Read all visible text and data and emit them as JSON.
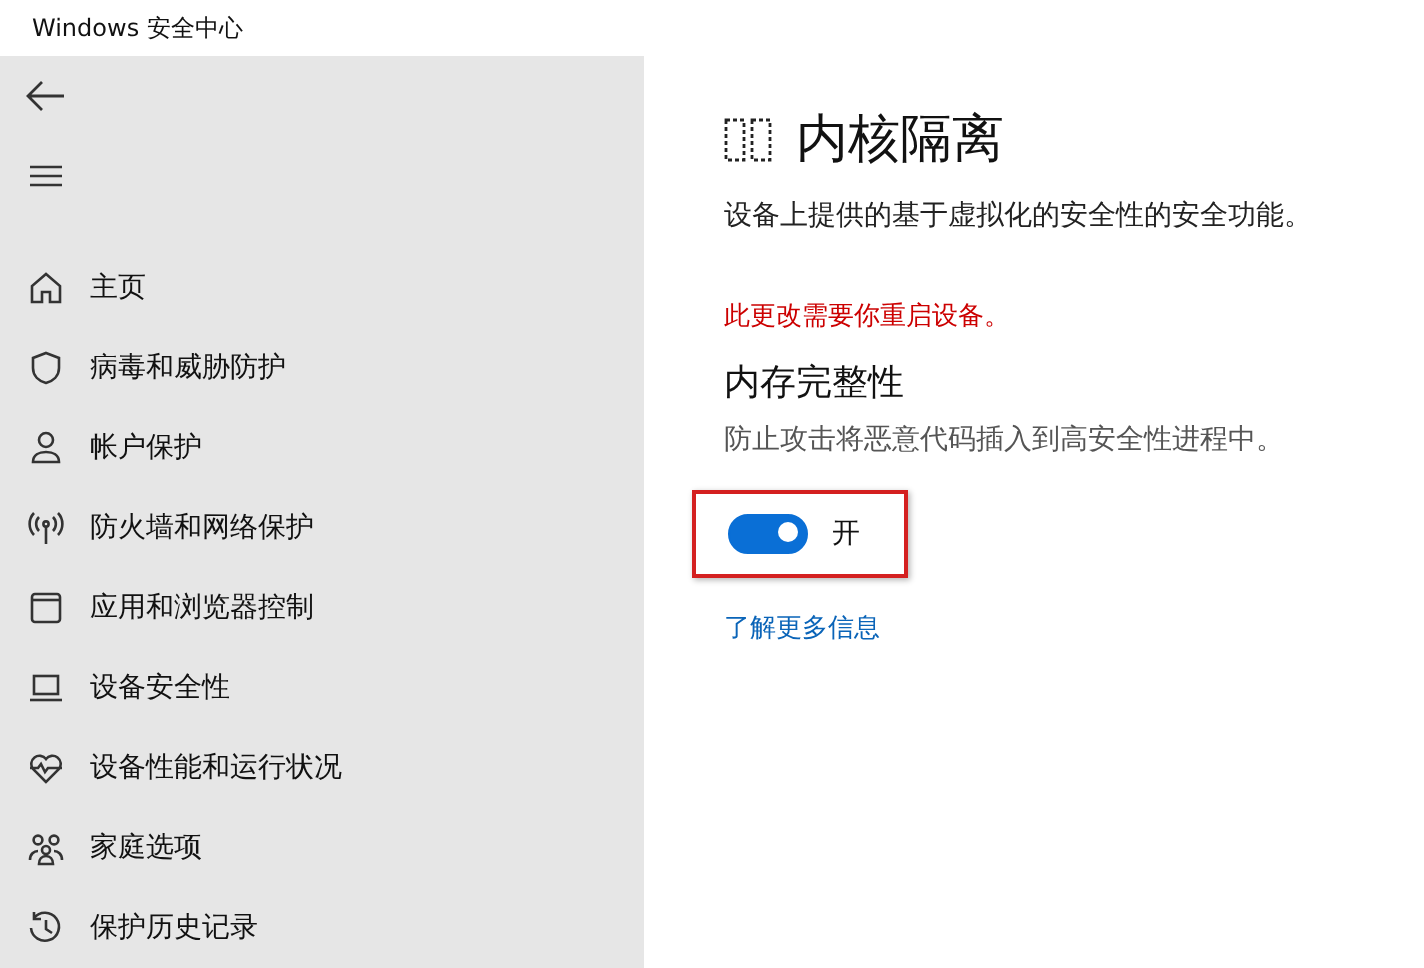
{
  "window": {
    "title": "Windows 安全中心"
  },
  "sidebar": {
    "items": [
      {
        "label": "主页"
      },
      {
        "label": "病毒和威胁防护"
      },
      {
        "label": "帐户保护"
      },
      {
        "label": "防火墙和网络保护"
      },
      {
        "label": "应用和浏览器控制"
      },
      {
        "label": "设备安全性"
      },
      {
        "label": "设备性能和运行状况"
      },
      {
        "label": "家庭选项"
      },
      {
        "label": "保护历史记录"
      }
    ]
  },
  "page": {
    "title": "内核隔离",
    "description": "设备上提供的基于虚拟化的安全性的安全功能。",
    "warning": "此更改需要你重启设备。",
    "section_title": "内存完整性",
    "section_description": "防止攻击将恶意代码插入到高安全性进程中。",
    "toggle": {
      "on": true,
      "label": "开",
      "highlighted": true
    },
    "link": "了解更多信息"
  }
}
